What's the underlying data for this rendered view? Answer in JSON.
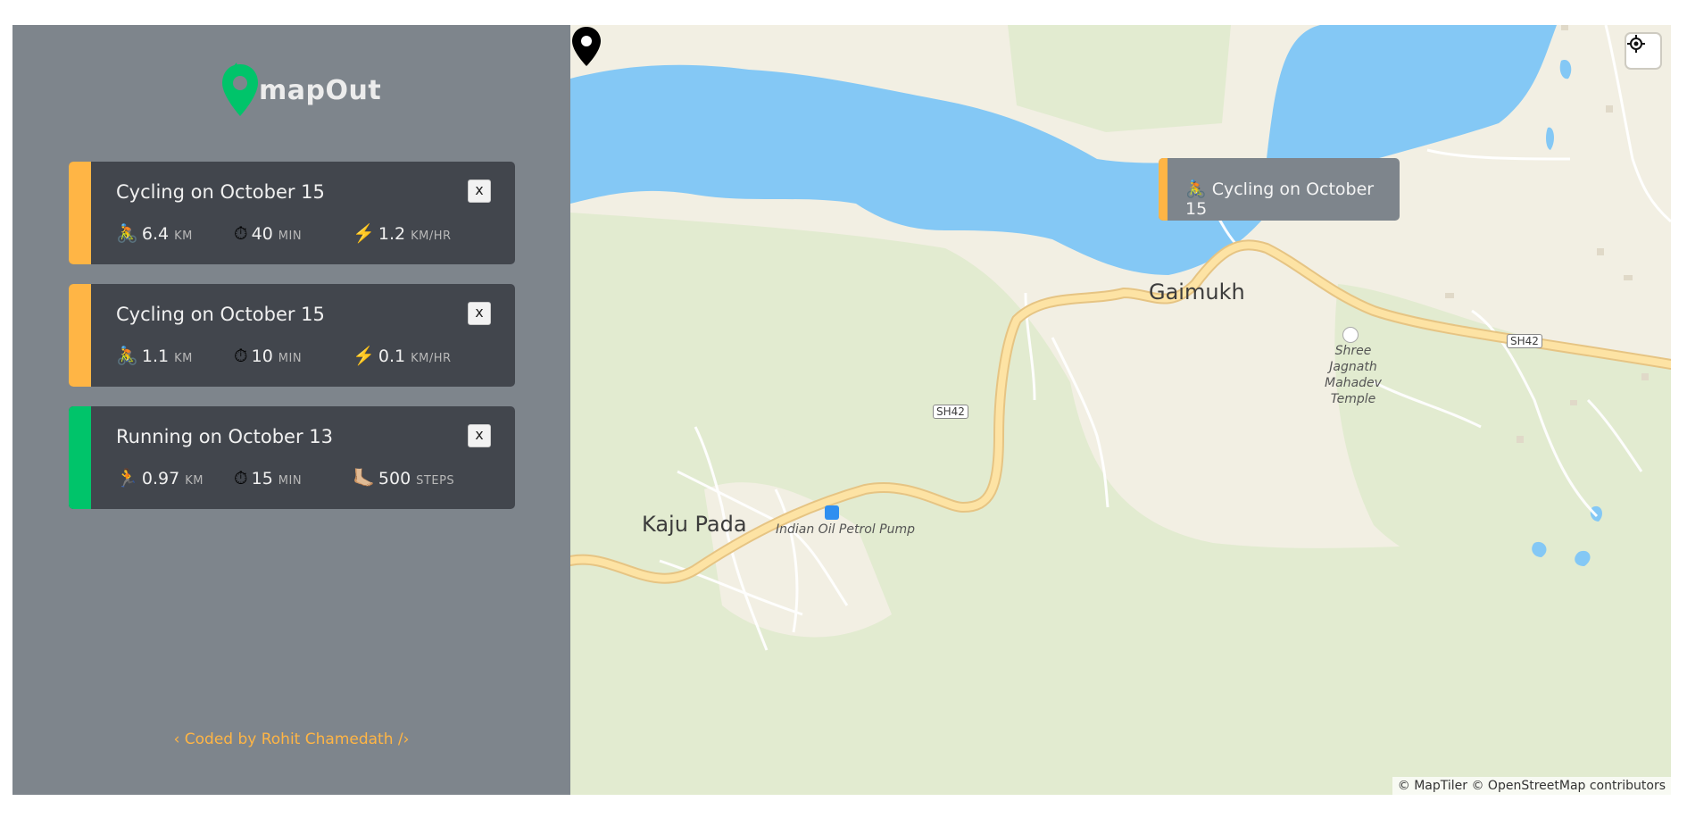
{
  "app": {
    "logo_text": "mapOut",
    "footer": "‹ Coded by Rohit Chamedath /›"
  },
  "colors": {
    "cycling": "#ffb545",
    "running": "#00c46a",
    "sidebar": "#7e858c",
    "card": "#42464d"
  },
  "workouts": [
    {
      "title": "Cycling on October 15",
      "type": "cycling",
      "close_label": "x",
      "details": [
        {
          "icon": "🚴",
          "value": "6.4",
          "unit": "km"
        },
        {
          "icon": "⏱",
          "value": "40",
          "unit": "min"
        },
        {
          "icon": "⚡️",
          "value": "1.2",
          "unit": "km/hr"
        }
      ]
    },
    {
      "title": "Cycling on October 15",
      "type": "cycling",
      "close_label": "x",
      "details": [
        {
          "icon": "🚴",
          "value": "1.1",
          "unit": "km"
        },
        {
          "icon": "⏱",
          "value": "10",
          "unit": "min"
        },
        {
          "icon": "⚡️",
          "value": "0.1",
          "unit": "km/hr"
        }
      ]
    },
    {
      "title": "Running on October 13",
      "type": "running",
      "close_label": "x",
      "details": [
        {
          "icon": "🏃",
          "value": "0.97",
          "unit": "km"
        },
        {
          "icon": "⏱",
          "value": "15",
          "unit": "min"
        },
        {
          "icon": "🦶🏼",
          "value": "500",
          "unit": "steps"
        }
      ]
    }
  ],
  "map": {
    "popup": {
      "icon": "🚴",
      "text": "Cycling on October 15"
    },
    "places": {
      "gaimukh": "Gaimukh",
      "kaju_pada": "Kaju Pada",
      "petrol_pump": "Indian Oil Petrol Pump",
      "temple_line1": "Shree Jagnath",
      "temple_line2": "Mahadev Temple",
      "road_label_1": "SH42",
      "road_label_2": "SH42"
    },
    "attribution": "© MapTiler © OpenStreetMap contributors"
  }
}
